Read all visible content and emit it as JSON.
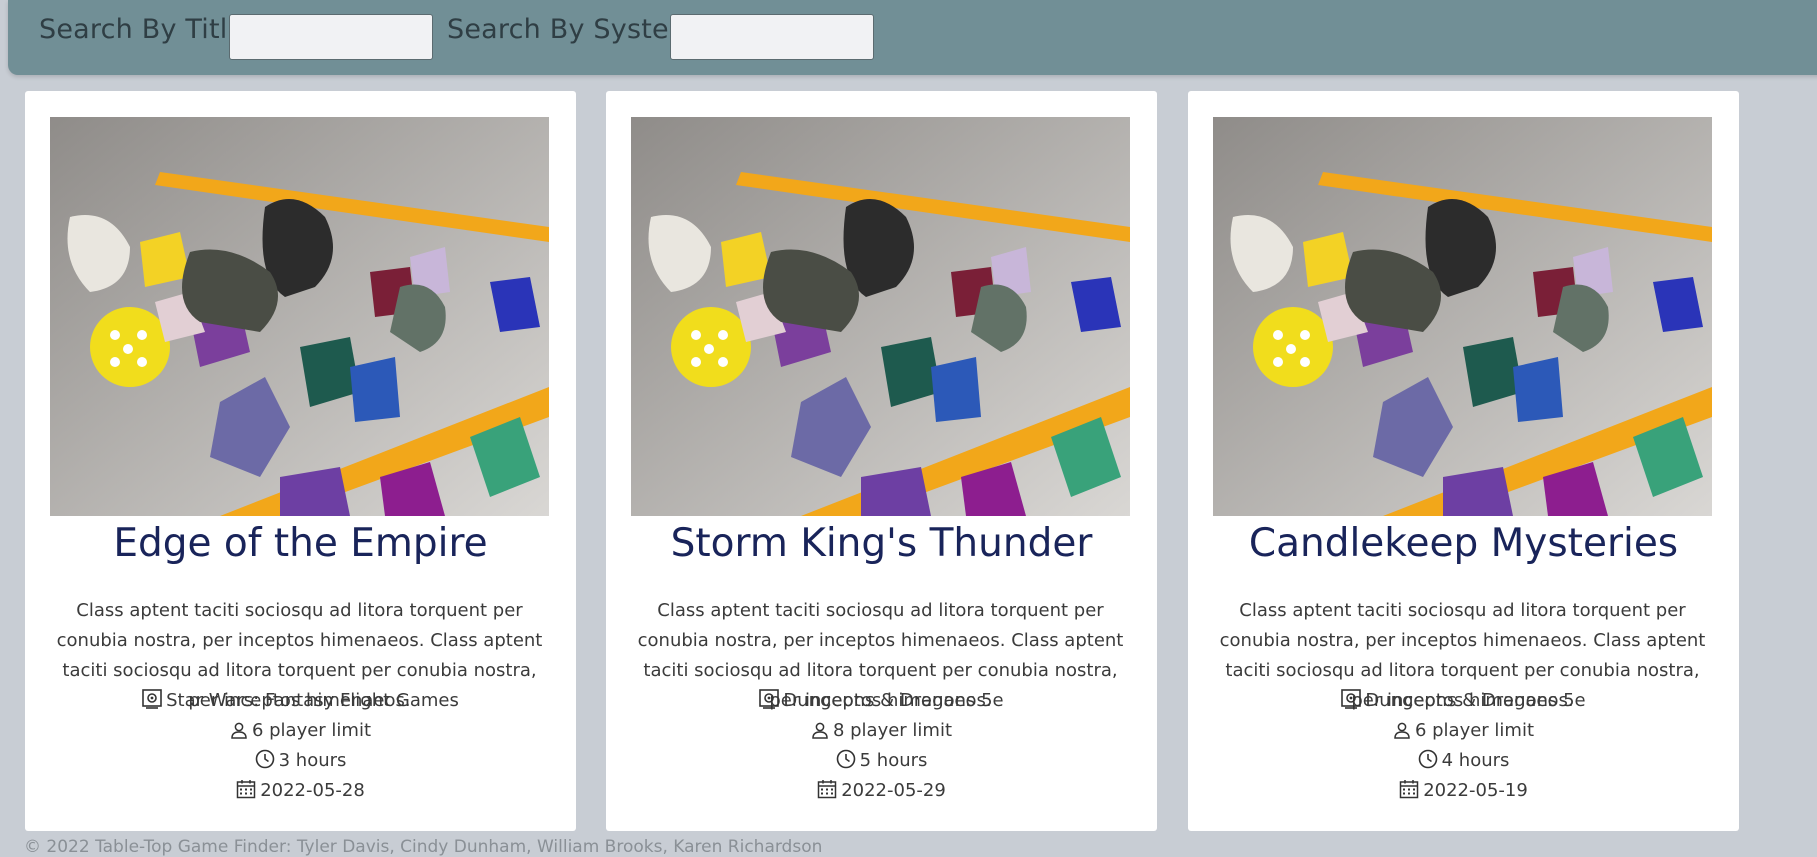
{
  "search": {
    "title_label": "Search By Title",
    "title_value": "",
    "system_label": "Search By System",
    "system_value": ""
  },
  "cards": [
    {
      "title": "Edge of the Empire",
      "description": "Class aptent taciti sociosqu ad litora torquent per conubia nostra, per inceptos himenaeos. Class aptent taciti sociosqu ad litora torquent per conubia nostra, per inceptos himenaeos.",
      "system": "Star Wars: Fantasy Flight Games",
      "players": "6 player limit",
      "duration": "3 hours",
      "date": "2022-05-28"
    },
    {
      "title": "Storm King's Thunder",
      "description": "Class aptent taciti sociosqu ad litora torquent per conubia nostra, per inceptos himenaeos. Class aptent taciti sociosqu ad litora torquent per conubia nostra, per inceptos himenaeos.",
      "system": "Dungeons & Dragons 5e",
      "players": "8 player limit",
      "duration": "5 hours",
      "date": "2022-05-29"
    },
    {
      "title": "Candlekeep Mysteries",
      "description": "Class aptent taciti sociosqu ad litora torquent per conubia nostra, per inceptos himenaeos. Class aptent taciti sociosqu ad litora torquent per conubia nostra, per inceptos himenaeos.",
      "system": "Dungeons & Dragons 5e",
      "players": "6 player limit",
      "duration": "4 hours",
      "date": "2022-05-19"
    }
  ],
  "icons": {
    "system": "gear-board-icon",
    "players": "person-icon",
    "duration": "clock-icon",
    "date": "calendar-icon"
  },
  "colors": {
    "header_bg": "#718f96",
    "page_bg": "#c8cdd4",
    "title_text": "#19245a"
  },
  "footer": {
    "text": "© 2022 Table-Top Game Finder: Tyler Davis, Cindy Dunham, William Brooks, Karen Richardson"
  }
}
